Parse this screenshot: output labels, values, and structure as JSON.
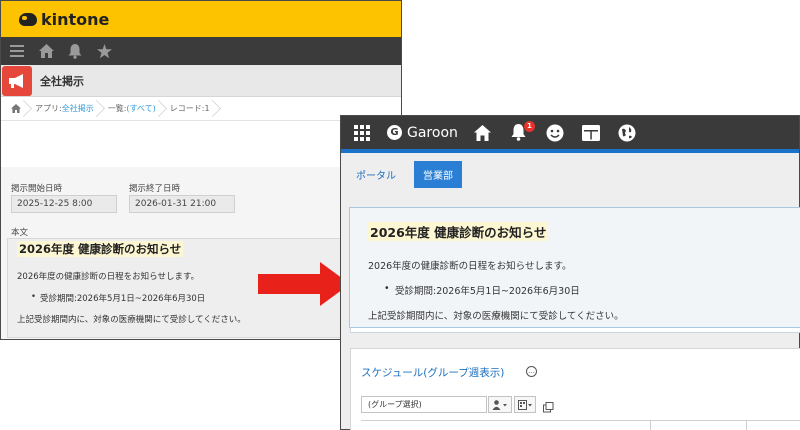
{
  "kintone": {
    "brand": "kintone",
    "app_title": "全社掲示",
    "breadcrumbs": {
      "app_prefix": "アプリ:",
      "app_name": "全社掲示",
      "list_prefix": "一覧:",
      "list_name": "(すべて)",
      "record": "レコード:1"
    },
    "fields": {
      "start_label": "掲示開始日時",
      "start_value": "2025-12-25 8:00",
      "end_label": "掲示終了日時",
      "end_value": "2026-01-31 21:00",
      "body_label": "本文"
    },
    "notice": {
      "title": "2026年度 健康診断のお知らせ",
      "line1": "2026年度の健康診断の日程をお知らせします。",
      "bullet": "受診期間:2026年5月1日~2026年6月30日",
      "line3": "上記受診期間内に、対象の医療機関にて受診してください。"
    }
  },
  "garoon": {
    "brand": "Garoon",
    "brand_mark": "G",
    "notification_count": "1",
    "tabs": [
      "ポータル",
      "営業部"
    ],
    "active_tab_index": 1,
    "notice": {
      "title": "2026年度 健康診断のお知らせ",
      "line1": "2026年度の健康診断の日程をお知らせします。",
      "bullet": "受診期間:2026年5月1日~2026年6月30日",
      "line3": "上記受診期間内に、対象の医療機関にて受診してください。"
    },
    "schedule": {
      "title": "スケジュール(グループ週表示)",
      "more_glyph": "…",
      "group_select": "(グループ選択)"
    }
  },
  "colors": {
    "kintone_yellow": "#fdc300",
    "garoon_blue": "#2a7fd4",
    "arrow_red": "#e8211a",
    "highlight": "#fcf6d2"
  }
}
